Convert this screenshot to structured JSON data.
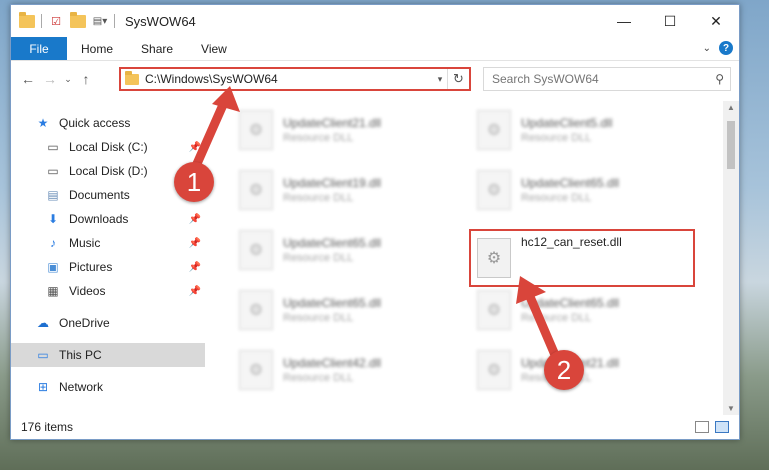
{
  "window": {
    "title": "SysWOW64"
  },
  "window_controls": {
    "minimize": "—",
    "maximize": "☐",
    "close": "✕"
  },
  "ribbon": {
    "file": "File",
    "tabs": [
      "Home",
      "Share",
      "View"
    ],
    "help": "?"
  },
  "nav": {
    "back": "←",
    "forward": "→",
    "recent": "⌄",
    "up": "↑",
    "address": "C:\\Windows\\SysWOW64",
    "search_placeholder": "Search SysWOW64"
  },
  "sidebar": {
    "quick_access": "Quick access",
    "items": [
      {
        "label": "Local Disk (C:)",
        "icon": "drive-icon",
        "pinned": true
      },
      {
        "label": "Local Disk (D:)",
        "icon": "drive-icon",
        "pinned": false
      },
      {
        "label": "Documents",
        "icon": "documents-icon",
        "pinned": true
      },
      {
        "label": "Downloads",
        "icon": "downloads-icon",
        "pinned": true
      },
      {
        "label": "Music",
        "icon": "music-icon",
        "pinned": true
      },
      {
        "label": "Pictures",
        "icon": "pictures-icon",
        "pinned": true
      },
      {
        "label": "Videos",
        "icon": "videos-icon",
        "pinned": true
      }
    ],
    "onedrive": "OneDrive",
    "this_pc": "This PC",
    "network": "Network"
  },
  "files": {
    "left": [
      {
        "name": "UpdateClient21.dll",
        "desc": "Resource DLL"
      },
      {
        "name": "UpdateClient19.dll",
        "desc": "Resource DLL"
      },
      {
        "name": "UpdateClient65.dll",
        "desc": "Resource DLL"
      },
      {
        "name": "UpdateClient65.dll",
        "desc": "Resource DLL"
      },
      {
        "name": "UpdateClient42.dll",
        "desc": "Resource DLL"
      }
    ],
    "right": [
      {
        "name": "UpdateClient5.dll",
        "desc": "Resource DLL"
      },
      {
        "name": "UpdateClient65.dll",
        "desc": "Resource DLL"
      },
      {
        "name": "hc12_can_reset.dll",
        "desc": ""
      },
      {
        "name": "UpdateClient65.dll",
        "desc": "Resource DLL"
      },
      {
        "name": "UpdateClient21.dll",
        "desc": "Resource DLL"
      }
    ]
  },
  "status": {
    "count": "176 items"
  },
  "annotations": {
    "step1": "1",
    "step2": "2",
    "color": "#d9453b"
  }
}
